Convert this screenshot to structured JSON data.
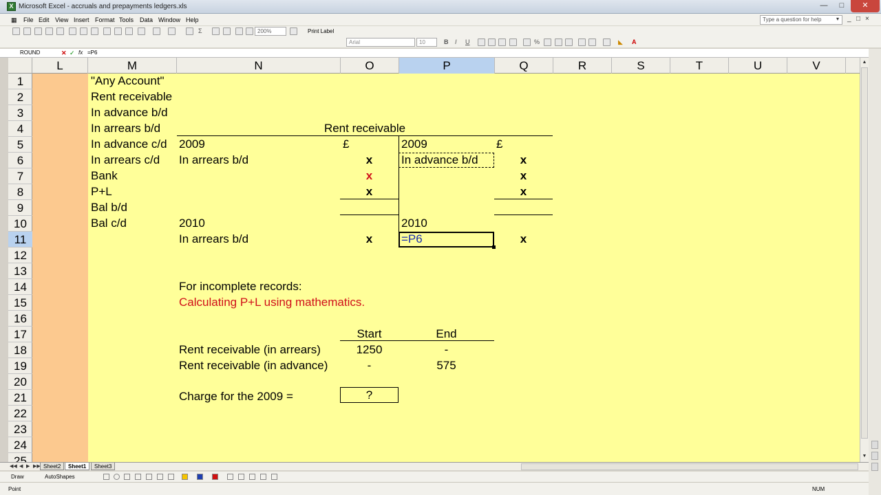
{
  "window": {
    "title": "Microsoft Excel - accruals and prepayments ledgers.xls"
  },
  "menu": [
    "File",
    "Edit",
    "View",
    "Insert",
    "Format",
    "Tools",
    "Data",
    "Window",
    "Help"
  ],
  "help_box": {
    "placeholder": "Type a question for help"
  },
  "toolbar": {
    "zoom": "200%",
    "print_label": "Print Label",
    "font": "Arial",
    "size": "10"
  },
  "formula_bar": {
    "name_box": "ROUND",
    "fx": "fx",
    "content": "=P6"
  },
  "columns": [
    "L",
    "M",
    "N",
    "O",
    "P",
    "Q",
    "R",
    "S",
    "T",
    "U",
    "V"
  ],
  "rows": [
    "1",
    "2",
    "3",
    "4",
    "5",
    "6",
    "7",
    "8",
    "9",
    "10",
    "11",
    "12",
    "13",
    "14",
    "15",
    "16",
    "17",
    "18",
    "19",
    "20",
    "21",
    "22",
    "23",
    "24",
    "25"
  ],
  "cells": {
    "M1": "\"Any Account\"",
    "M2": "Rent receivable",
    "M3": "In advance b/d",
    "M4": "In arrears b/d",
    "M5": "In advance c/d",
    "M6": "In arrears c/d",
    "M7": "Bank",
    "M8": "P+L",
    "M9": "Bal b/d",
    "M10": "Bal c/d",
    "ledger_title": "Rent receivable",
    "N5": "2009",
    "O5": "£",
    "P5": "2009",
    "Q5": "£",
    "N6": "In arrears b/d",
    "O6": "x",
    "P6": "In advance b/d",
    "Q6": "x",
    "O7": "x",
    "Q7": "x",
    "O8": "x",
    "Q8": "x",
    "N10": "2010",
    "P10": "2010",
    "N11": "In arrears b/d",
    "O11": "x",
    "P11": "=P6",
    "Q11": "x",
    "N14": "For incomplete records:",
    "N15": "Calculating P+L using mathematics.",
    "O17": "Start",
    "P17": "End",
    "N18": "Rent receivable (in arrears)",
    "O18": "1250",
    "P18": "-",
    "N19": "Rent receivable (in advance)",
    "O19": "-",
    "P19": "575",
    "N21": "Charge for the 2009 =",
    "O21": "?"
  },
  "sheets": [
    "Sheet2",
    "Sheet1",
    "Sheet3"
  ],
  "drawing": {
    "draw": "Draw",
    "autoshapes": "AutoShapes"
  },
  "status": {
    "mode": "Point",
    "num": "NUM"
  },
  "colors": {
    "grid_fill": "#ffff99",
    "column_l_fill": "#fcc98f",
    "red_text": "#d0101a",
    "selected_header": "#b9d2ef"
  }
}
